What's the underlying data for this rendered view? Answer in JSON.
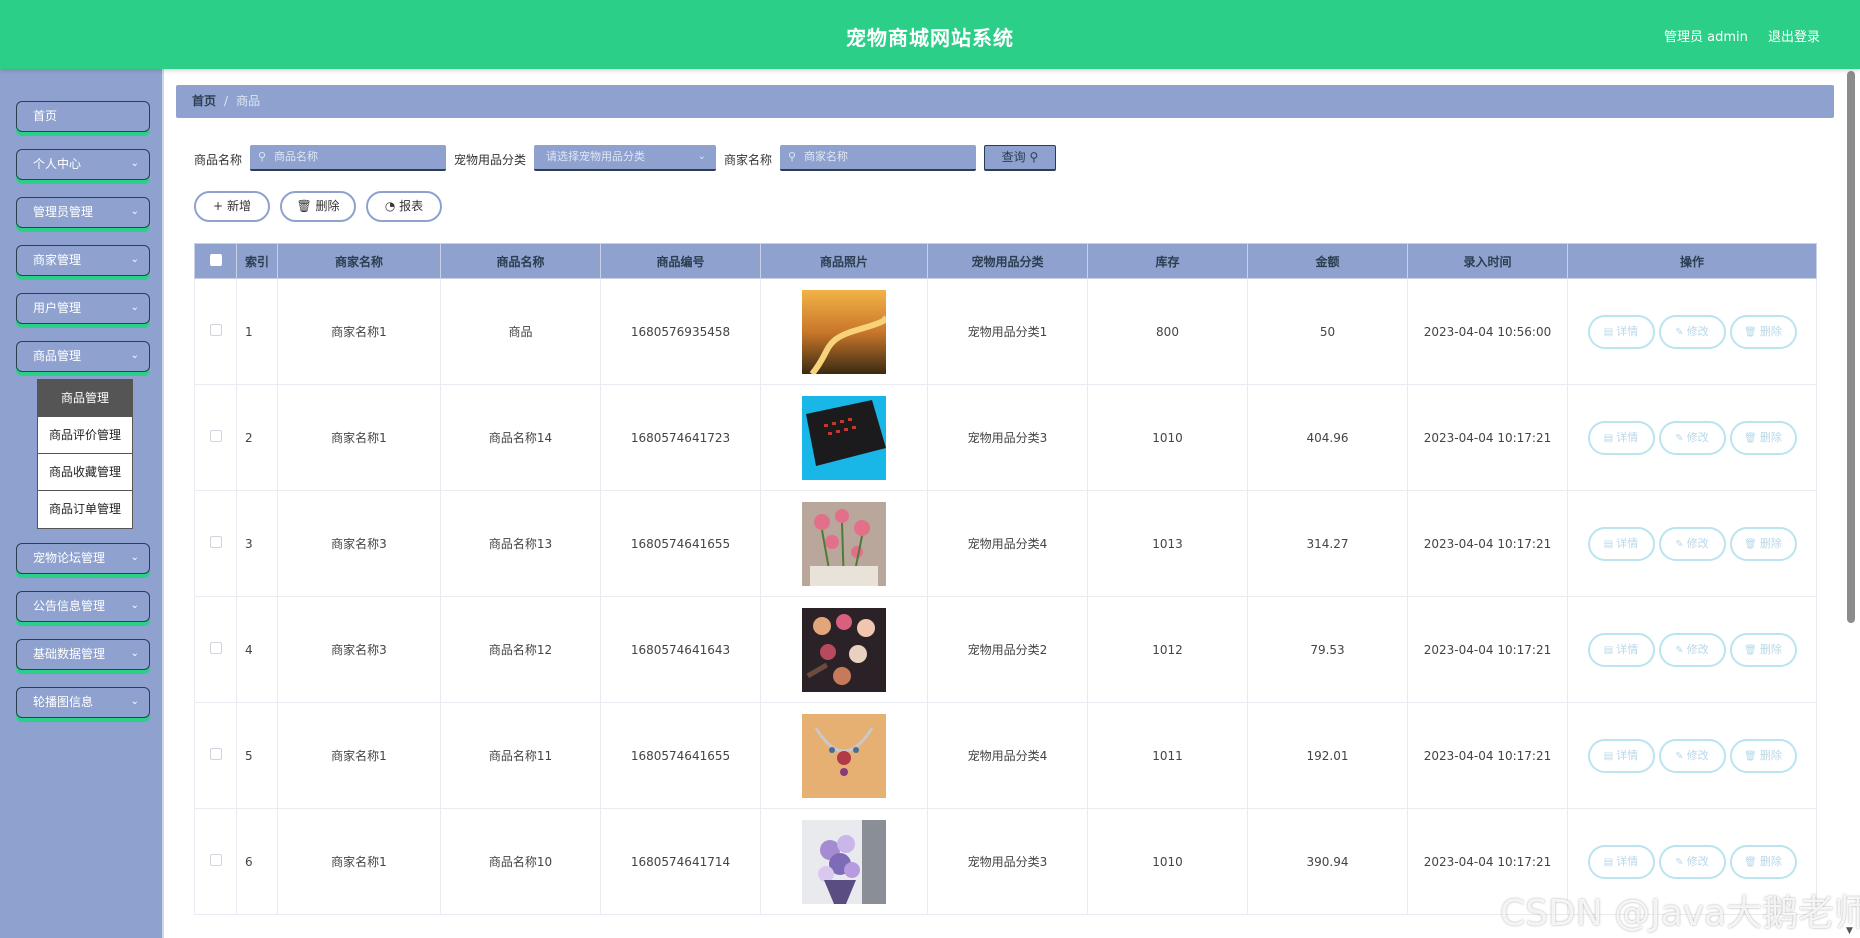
{
  "header": {
    "title": "宠物商城网站系统",
    "user": "管理员 admin",
    "logout": "退出登录"
  },
  "sidebar": {
    "items": [
      {
        "label": "首页",
        "chevron": false
      },
      {
        "label": "个人中心",
        "chevron": true
      },
      {
        "label": "管理员管理",
        "chevron": true
      },
      {
        "label": "商家管理",
        "chevron": true
      },
      {
        "label": "用户管理",
        "chevron": true
      },
      {
        "label": "商品管理",
        "chevron": true
      },
      {
        "label": "宠物论坛管理",
        "chevron": true
      },
      {
        "label": "公告信息管理",
        "chevron": true
      },
      {
        "label": "基础数据管理",
        "chevron": true
      },
      {
        "label": "轮播图信息",
        "chevron": true
      }
    ],
    "submenu": [
      "商品管理",
      "商品评价管理",
      "商品收藏管理",
      "商品订单管理"
    ],
    "active_sub": "商品管理"
  },
  "breadcrumb": {
    "home": "首页",
    "separator": "/",
    "current": "商品"
  },
  "search": {
    "goods_label": "商品名称",
    "goods_placeholder": "商品名称",
    "category_label": "宠物用品分类",
    "category_placeholder": "请选择宠物用品分类",
    "merchant_label": "商家名称",
    "merchant_placeholder": "商家名称",
    "query_label": "查询"
  },
  "actions": {
    "add": "新增",
    "delete": "删除",
    "report": "报表"
  },
  "table": {
    "columns": [
      "索引",
      "商家名称",
      "商品名称",
      "商品编号",
      "商品照片",
      "宠物用品分类",
      "库存",
      "金额",
      "录入时间",
      "操作"
    ],
    "row_ops": {
      "detail": "详情",
      "edit": "修改",
      "delete": "删除"
    },
    "rows": [
      {
        "index": "1",
        "merchant": "商家名称1",
        "goods": "商品",
        "code": "1680576935458",
        "category": "宠物用品分类1",
        "stock": "800",
        "price": "50",
        "time": "2023-04-04 10:56:00"
      },
      {
        "index": "2",
        "merchant": "商家名称1",
        "goods": "商品名称14",
        "code": "1680574641723",
        "category": "宠物用品分类3",
        "stock": "1010",
        "price": "404.96",
        "time": "2023-04-04 10:17:21"
      },
      {
        "index": "3",
        "merchant": "商家名称3",
        "goods": "商品名称13",
        "code": "1680574641655",
        "category": "宠物用品分类4",
        "stock": "1013",
        "price": "314.27",
        "time": "2023-04-04 10:17:21"
      },
      {
        "index": "4",
        "merchant": "商家名称3",
        "goods": "商品名称12",
        "code": "1680574641643",
        "category": "宠物用品分类2",
        "stock": "1012",
        "price": "79.53",
        "time": "2023-04-04 10:17:21"
      },
      {
        "index": "5",
        "merchant": "商家名称1",
        "goods": "商品名称11",
        "code": "1680574641655",
        "category": "宠物用品分类4",
        "stock": "1011",
        "price": "192.01",
        "time": "2023-04-04 10:17:21"
      },
      {
        "index": "6",
        "merchant": "商家名称1",
        "goods": "商品名称10",
        "code": "1680574641714",
        "category": "宠物用品分类3",
        "stock": "1010",
        "price": "390.94",
        "time": "2023-04-04 10:17:21"
      }
    ]
  },
  "watermark": "CSDN @Java大鹅老师",
  "colors": {
    "header": "#2ccf88",
    "sidebar": "#8fa2cf",
    "border_dark": "#2c3e50",
    "op_border": "#b9e4f0"
  }
}
